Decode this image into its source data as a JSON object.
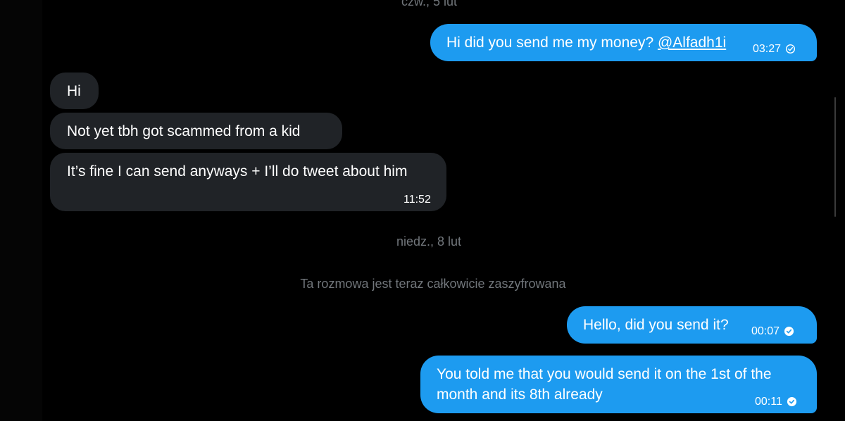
{
  "conversation": {
    "date_top": "czw., 5 lut",
    "date_mid": "niedz., 8 lut",
    "encryption_note": "Ta rozmowa jest teraz całkowicie zaszyfrowana",
    "messages": [
      {
        "text": "Hi did you send me my money? ",
        "mention": "@Alfadh1i",
        "time": "03:27",
        "status_icon": "sent-check-outline-icon"
      },
      {
        "text": "Hi"
      },
      {
        "text": "Not yet tbh got scammed from a kid"
      },
      {
        "text": "It’s fine I can send anyways + I’ll do tweet about him",
        "time": "11:52"
      },
      {
        "text": "Hello, did you send it?",
        "time": "00:07",
        "status_icon": "read-check-filled-icon"
      },
      {
        "text": "You told me that you would send it on the 1st of the month and its 8th already",
        "time": "00:11",
        "status_icon": "read-check-filled-icon"
      }
    ]
  },
  "colors": {
    "outgoing_bubble": "#1d9bf0",
    "incoming_bubble": "#202327",
    "muted_text": "#71767b",
    "background": "#000000"
  }
}
